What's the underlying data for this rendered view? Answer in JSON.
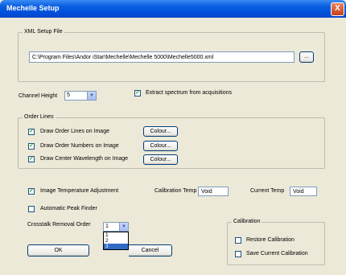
{
  "window": {
    "title": "Mechelle Setup",
    "close_glyph": "X"
  },
  "xml_setup": {
    "legend": "XML Setup File",
    "path": "C:\\Program Files\\Andor iStar\\Mechelle\\Mechelle 5000\\Mechelle5000.xml",
    "browse_label": "..."
  },
  "channel_height": {
    "label": "Channel Height",
    "value": "5"
  },
  "extract_spectrum": {
    "label": "Extract spectrum from acquisitions",
    "checked": true
  },
  "order_lines": {
    "legend": "Order Lines",
    "items": [
      {
        "label": "Draw Order Lines on Image",
        "checked": true,
        "button": "Colour..."
      },
      {
        "label": "Draw Order Numbers on Image",
        "checked": true,
        "button": "Colour..."
      },
      {
        "label": "Draw Center Wavelength on Image",
        "checked": true,
        "button": "Colour..."
      }
    ]
  },
  "image_temp": {
    "label": "Image Temperature Adjustment",
    "checked": true
  },
  "calibration_temp": {
    "label": "Calibration Temp",
    "value": "Void"
  },
  "current_temp": {
    "label": "Current Temp",
    "value": "Void"
  },
  "auto_peak": {
    "label": "Automatic Peak Finder",
    "checked": false
  },
  "crosstalk": {
    "label": "Crosstalk Removal Order",
    "value": "1",
    "options": [
      "1",
      "2",
      "3"
    ],
    "highlighted": "3"
  },
  "calibration": {
    "legend": "Calibration",
    "restore_label": "Restore Calibration",
    "save_label": "Save Current Calibration"
  },
  "buttons": {
    "ok": "OK",
    "cancel_partial": "Cancel"
  },
  "colors": {
    "title_bar": "#0a5fe0",
    "face": "#ece9d8",
    "selection": "#316ac5"
  }
}
